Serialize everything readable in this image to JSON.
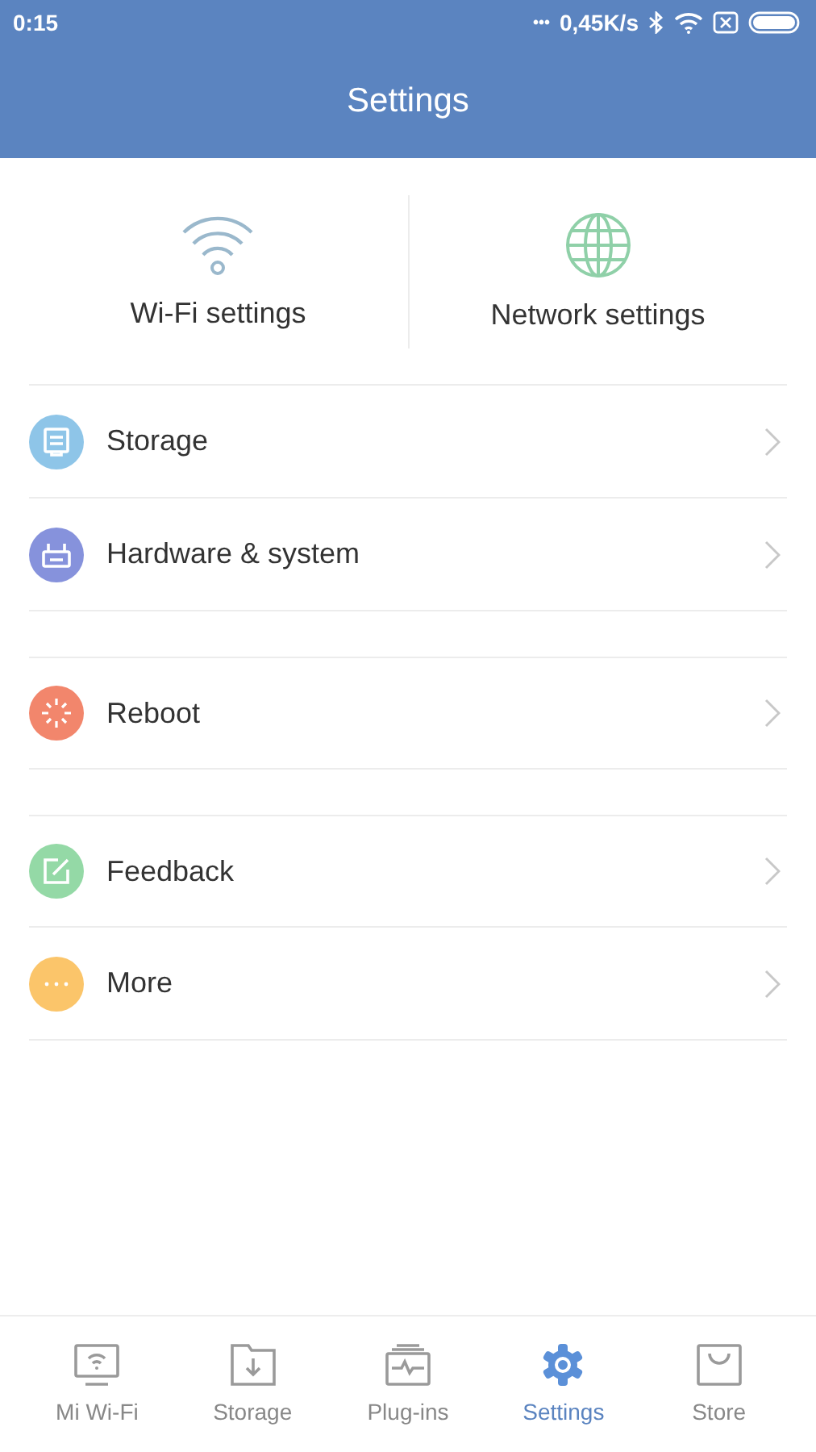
{
  "status_bar": {
    "time": "0:15",
    "dots": "•••",
    "speed": "0,45K/s"
  },
  "title": "Settings",
  "quick_settings": [
    {
      "label": "Wi-Fi settings",
      "kind": "wifi"
    },
    {
      "label": "Network settings",
      "kind": "globe"
    }
  ],
  "menu_groups": [
    [
      {
        "label": "Storage",
        "kind": "storage",
        "color": "#8ec5e8"
      },
      {
        "label": "Hardware & system",
        "kind": "router",
        "color": "#8692dc"
      }
    ],
    [
      {
        "label": "Reboot",
        "kind": "reboot",
        "color": "#f2866c"
      }
    ],
    [
      {
        "label": "Feedback",
        "kind": "feedback",
        "color": "#94d9a6"
      },
      {
        "label": "More",
        "kind": "more",
        "color": "#fbc56a"
      }
    ]
  ],
  "tabs": [
    {
      "label": "Mi Wi-Fi",
      "kind": "wifi",
      "selected": false
    },
    {
      "label": "Storage",
      "kind": "storage",
      "selected": false
    },
    {
      "label": "Plug-ins",
      "kind": "plugins",
      "selected": false
    },
    {
      "label": "Settings",
      "kind": "gear",
      "selected": true
    },
    {
      "label": "Store",
      "kind": "store",
      "selected": false
    }
  ]
}
